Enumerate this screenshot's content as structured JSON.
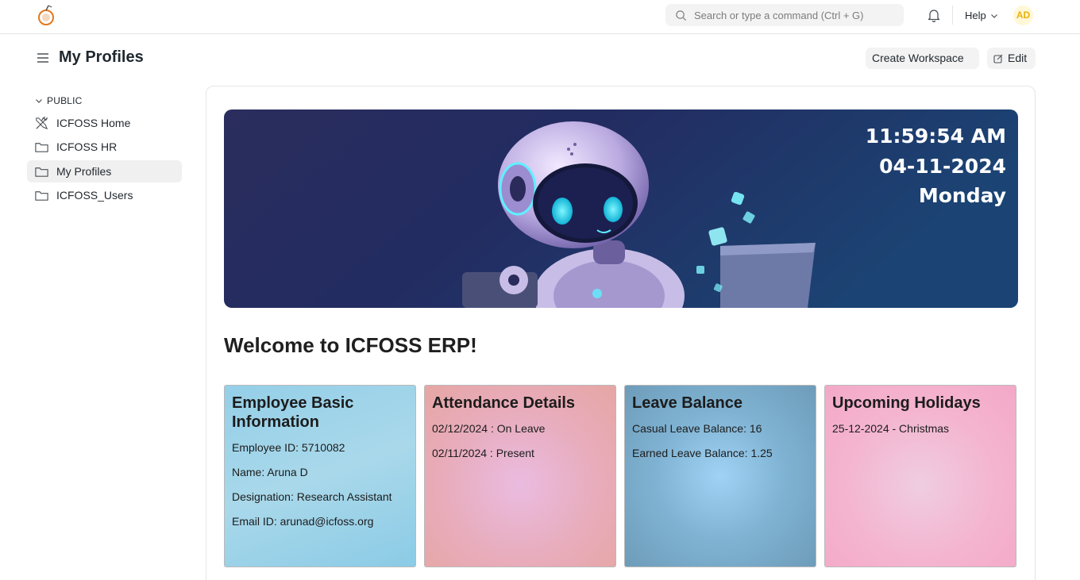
{
  "navbar": {
    "search_placeholder": "Search or type a command (Ctrl + G)",
    "help_label": "Help",
    "avatar_initials": "AD",
    "icons": [
      "app-logo-icon",
      "search-icon",
      "bell-icon",
      "chevron-down-icon"
    ]
  },
  "page": {
    "title": "My Profiles",
    "create_workspace_label": "Create Workspace",
    "edit_label": "Edit"
  },
  "sidebar": {
    "section_label": "PUBLIC",
    "items": [
      {
        "label": "ICFOSS Home",
        "icon": "tools-icon",
        "active": false
      },
      {
        "label": "ICFOSS HR",
        "icon": "folder-icon",
        "active": false
      },
      {
        "label": "My Profiles",
        "icon": "folder-icon",
        "active": true
      },
      {
        "label": "ICFOSS_Users",
        "icon": "folder-icon",
        "active": false
      }
    ]
  },
  "banner": {
    "time": "11:59:54 AM",
    "date": "04-11-2024",
    "day": "Monday"
  },
  "welcome": "Welcome to ICFOSS ERP!",
  "cards": [
    {
      "title": "Employee Basic Information",
      "lines": [
        "Employee ID: 5710082",
        "Name: Aruna D",
        "Designation: Research Assistant",
        "Email ID: arunad@icfoss.org"
      ]
    },
    {
      "title": "Attendance Details",
      "lines": [
        "02/12/2024 : On Leave",
        "02/11/2024 : Present"
      ]
    },
    {
      "title": "Leave Balance",
      "lines": [
        "Casual Leave Balance: 16",
        "Earned Leave Balance: 1.25"
      ]
    },
    {
      "title": "Upcoming Holidays",
      "lines": [
        "25-12-2024 - Christmas"
      ]
    }
  ],
  "colors": {
    "avatar_bg": "#fff7d6",
    "avatar_text": "#e8b20c",
    "card_employee": "#94cfe8",
    "card_attendance": "#e8abb8",
    "card_leave": "#7fb2d2",
    "card_holidays": "#f4b4cf"
  }
}
